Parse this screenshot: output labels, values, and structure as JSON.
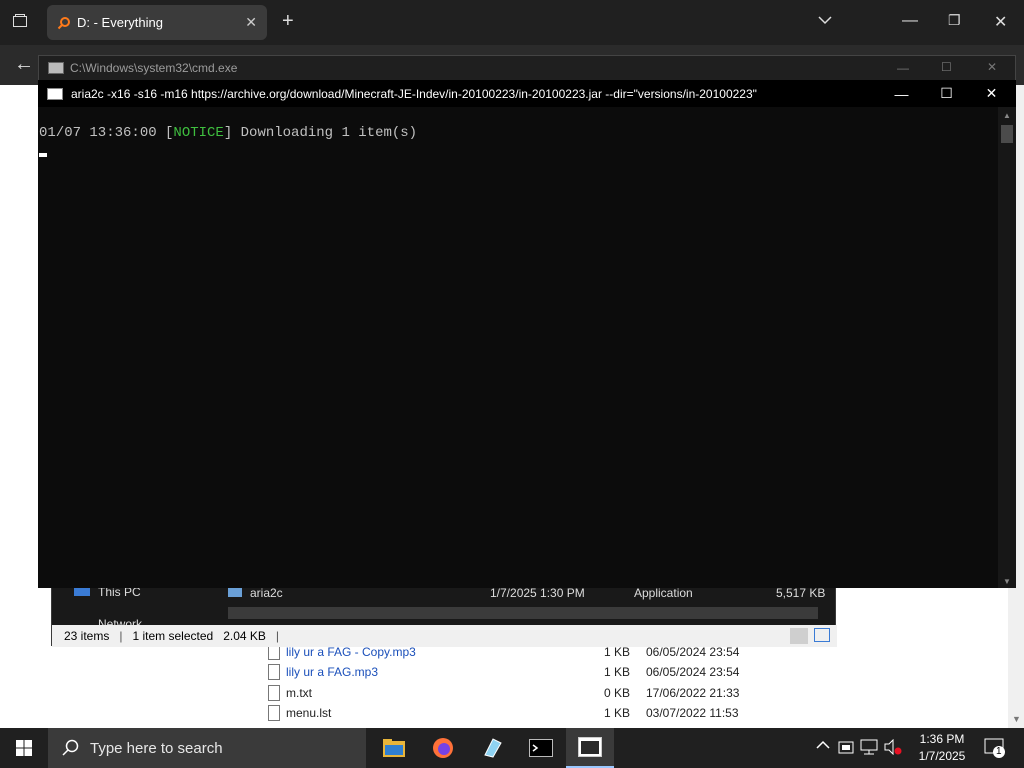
{
  "browser": {
    "tab_title": "D: - Everything",
    "tab_close": "✕",
    "new_tab": "+",
    "tab_menu": "⌄",
    "back": "←",
    "min": "—",
    "max": "❐",
    "close": "✕"
  },
  "explorer": {
    "nav_item_this_pc": "This PC",
    "nav_item_network": "Network",
    "file_name": "aria2c",
    "file_date": "1/7/2025 1:30 PM",
    "file_type": "Application",
    "file_size": "5,517 KB",
    "status_items": "23 items",
    "status_selected": "1 item selected",
    "status_size": "2.04 KB"
  },
  "file_list": [
    {
      "name": "lily ur a FAG - Copy.mp3",
      "size": "1 KB",
      "date": "06/05/2024 23:54"
    },
    {
      "name": "lily ur a FAG.mp3",
      "size": "1 KB",
      "date": "06/05/2024 23:54"
    },
    {
      "name": "m.txt",
      "size": "0 KB",
      "date": "17/06/2022 21:33"
    },
    {
      "name": "menu.lst",
      "size": "1 KB",
      "date": "03/07/2022 11:53"
    }
  ],
  "cmd_outer": {
    "title": "C:\\Windows\\system32\\cmd.exe"
  },
  "cmd_inner": {
    "title": "aria2c  -x16 -s16 -m16 https://archive.org/download/Minecraft-JE-Indev/in-20100223/in-20100223.jar --dir=\"versions/in-20100223\"",
    "line_time": "01/07 13:36:00 [",
    "line_notice": "NOTICE",
    "line_rest": "] Downloading 1 item(s)"
  },
  "taskbar": {
    "search_placeholder": "Type here to search",
    "time": "1:36 PM",
    "date": "1/7/2025",
    "notif_count": "1"
  }
}
